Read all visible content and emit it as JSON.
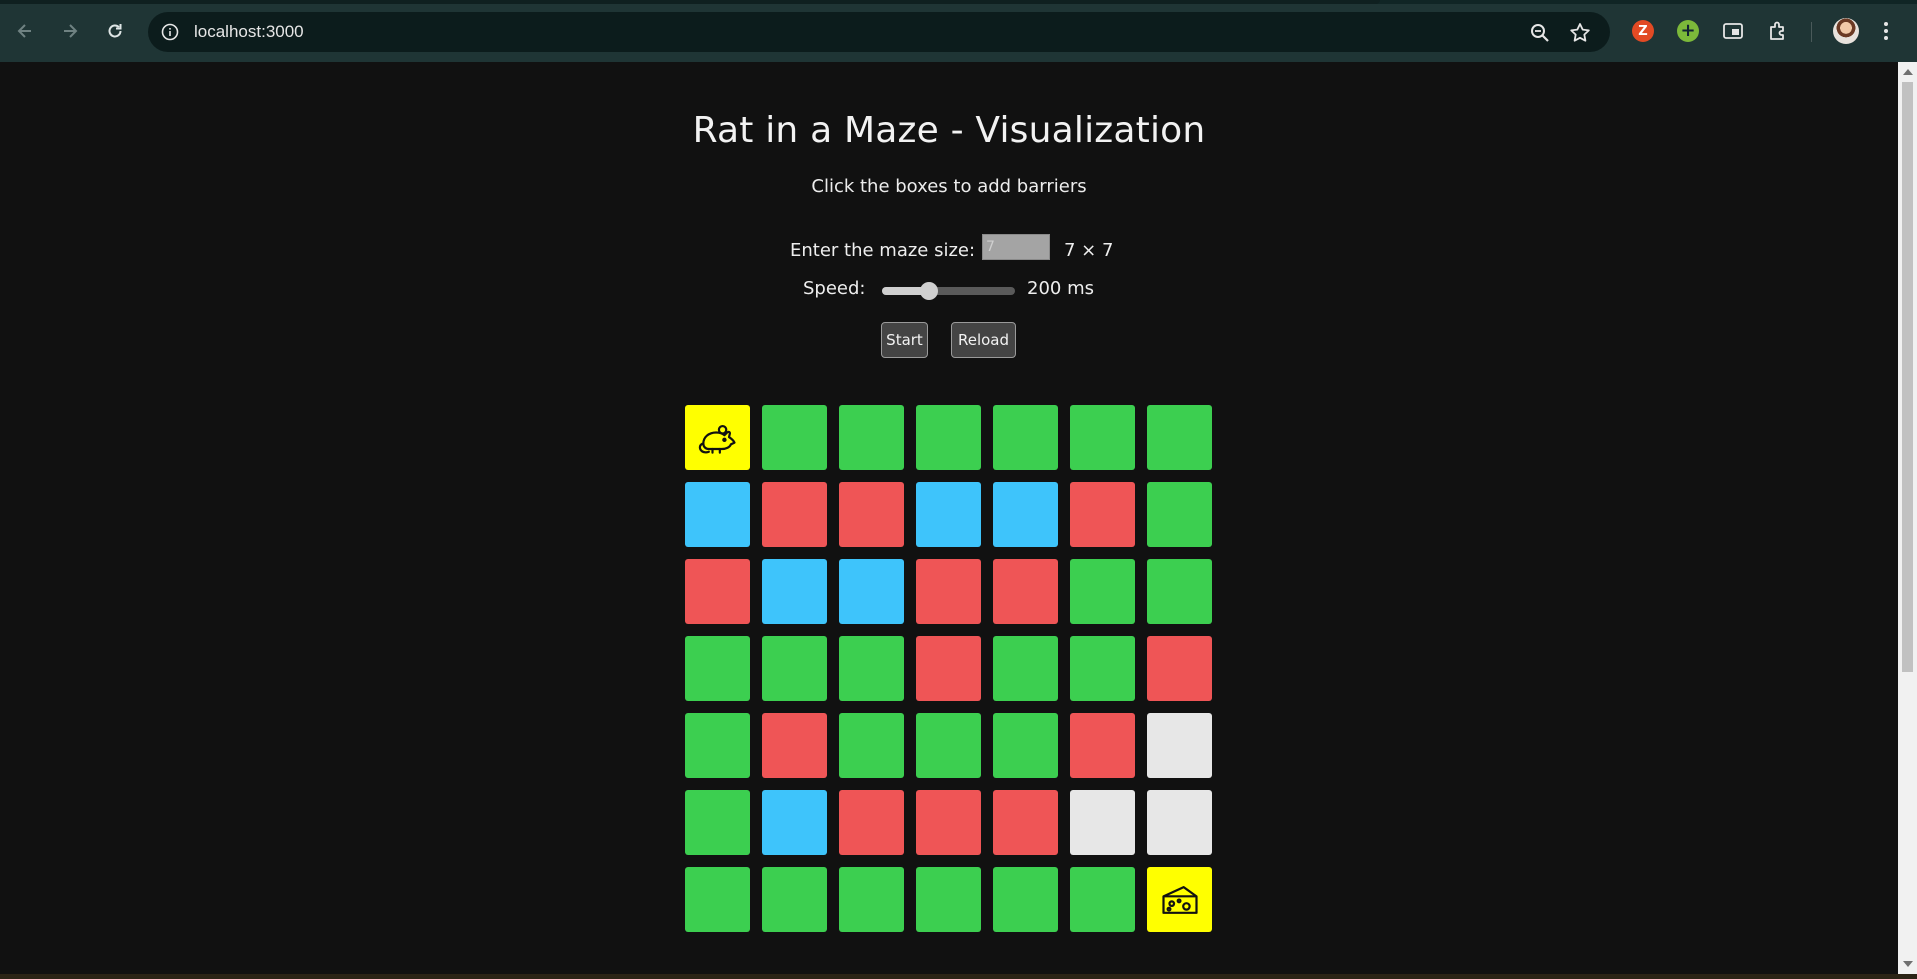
{
  "browser": {
    "url": "localhost:3000",
    "extension_z_label": "Z",
    "extension_plus_label": "+"
  },
  "page": {
    "title": "Rat in a Maze - Visualization",
    "subtitle": "Click the boxes to add barriers",
    "size_label": "Enter the maze size:",
    "size_value": "7",
    "size_dimension": "7 × 7",
    "speed_label": "Speed:",
    "speed_value_text": "200 ms",
    "speed_fraction": 0.35,
    "start_label": "Start",
    "reload_label": "Reload"
  },
  "colors": {
    "open": "#3ccf50",
    "barrier": "#ef5556",
    "path": "#3ec4fb",
    "unvisited": "#e7e7e7",
    "endpoint": "#ffff00"
  },
  "maze": {
    "size": 7,
    "grid": [
      [
        "rat",
        "open",
        "open",
        "open",
        "open",
        "open",
        "open"
      ],
      [
        "path",
        "barrier",
        "barrier",
        "path",
        "path",
        "barrier",
        "open"
      ],
      [
        "barrier",
        "path",
        "path",
        "barrier",
        "barrier",
        "open",
        "open"
      ],
      [
        "open",
        "open",
        "open",
        "barrier",
        "open",
        "open",
        "barrier"
      ],
      [
        "open",
        "barrier",
        "open",
        "open",
        "open",
        "barrier",
        "unvisited"
      ],
      [
        "open",
        "path",
        "barrier",
        "barrier",
        "barrier",
        "unvisited",
        "unvisited"
      ],
      [
        "open",
        "open",
        "open",
        "open",
        "open",
        "open",
        "cheese"
      ]
    ]
  }
}
